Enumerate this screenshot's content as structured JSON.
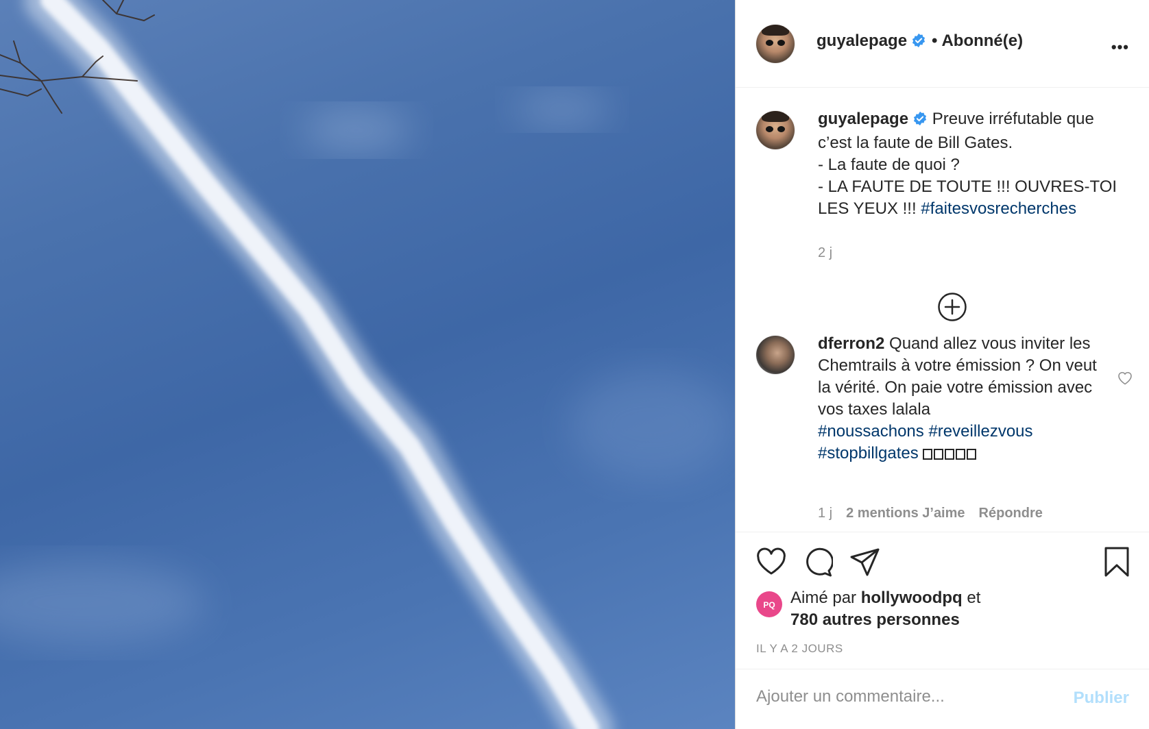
{
  "post": {
    "author": "guyalepage",
    "separator": "•",
    "follow_status": "Abonné(e)",
    "more_label": "•••"
  },
  "caption": {
    "username": "guyalepage",
    "line1": "Preuve irréfutable que c’est la faute de Bill Gates.",
    "line2": "- La faute de quoi ?",
    "line3": "- LA FAUTE DE TOUTE !!! OUVRES-TOI LES YEUX !!!",
    "hashtag": "#faitesvosrecherches",
    "time": "2 j"
  },
  "comment": {
    "username": "dferron2",
    "text": "Quand allez vous inviter les Chemtrails à votre émission ? On veut la vérité. On paie votre émission avec vos taxes lalala",
    "tag1": "#noussachons",
    "tag2": "#reveillezvous",
    "tag3": "#stopbillgates",
    "time": "1 j",
    "likes": "2 mentions J’aime",
    "reply": "Répondre"
  },
  "likes": {
    "prefix": "Aimé par",
    "user": "hollywoodpq",
    "mid": "et",
    "others": "780 autres personnes",
    "liker_avatar_text": "PQ"
  },
  "posted_ago": "IL Y A 2 JOURS",
  "add_comment": {
    "placeholder": "Ajouter un commentaire...",
    "publish": "Publier"
  },
  "icons": {
    "verified": "verified-badge-icon",
    "more": "more-options-icon",
    "plus": "load-more-comments-icon",
    "like": "heart-icon",
    "comment": "comment-icon",
    "share": "share-icon",
    "save": "bookmark-icon"
  },
  "colors": {
    "hashtag": "#00376b",
    "verified": "#3897f0",
    "publish_disabled": "#b2dffc",
    "liker_avatar": "#e9478a"
  }
}
